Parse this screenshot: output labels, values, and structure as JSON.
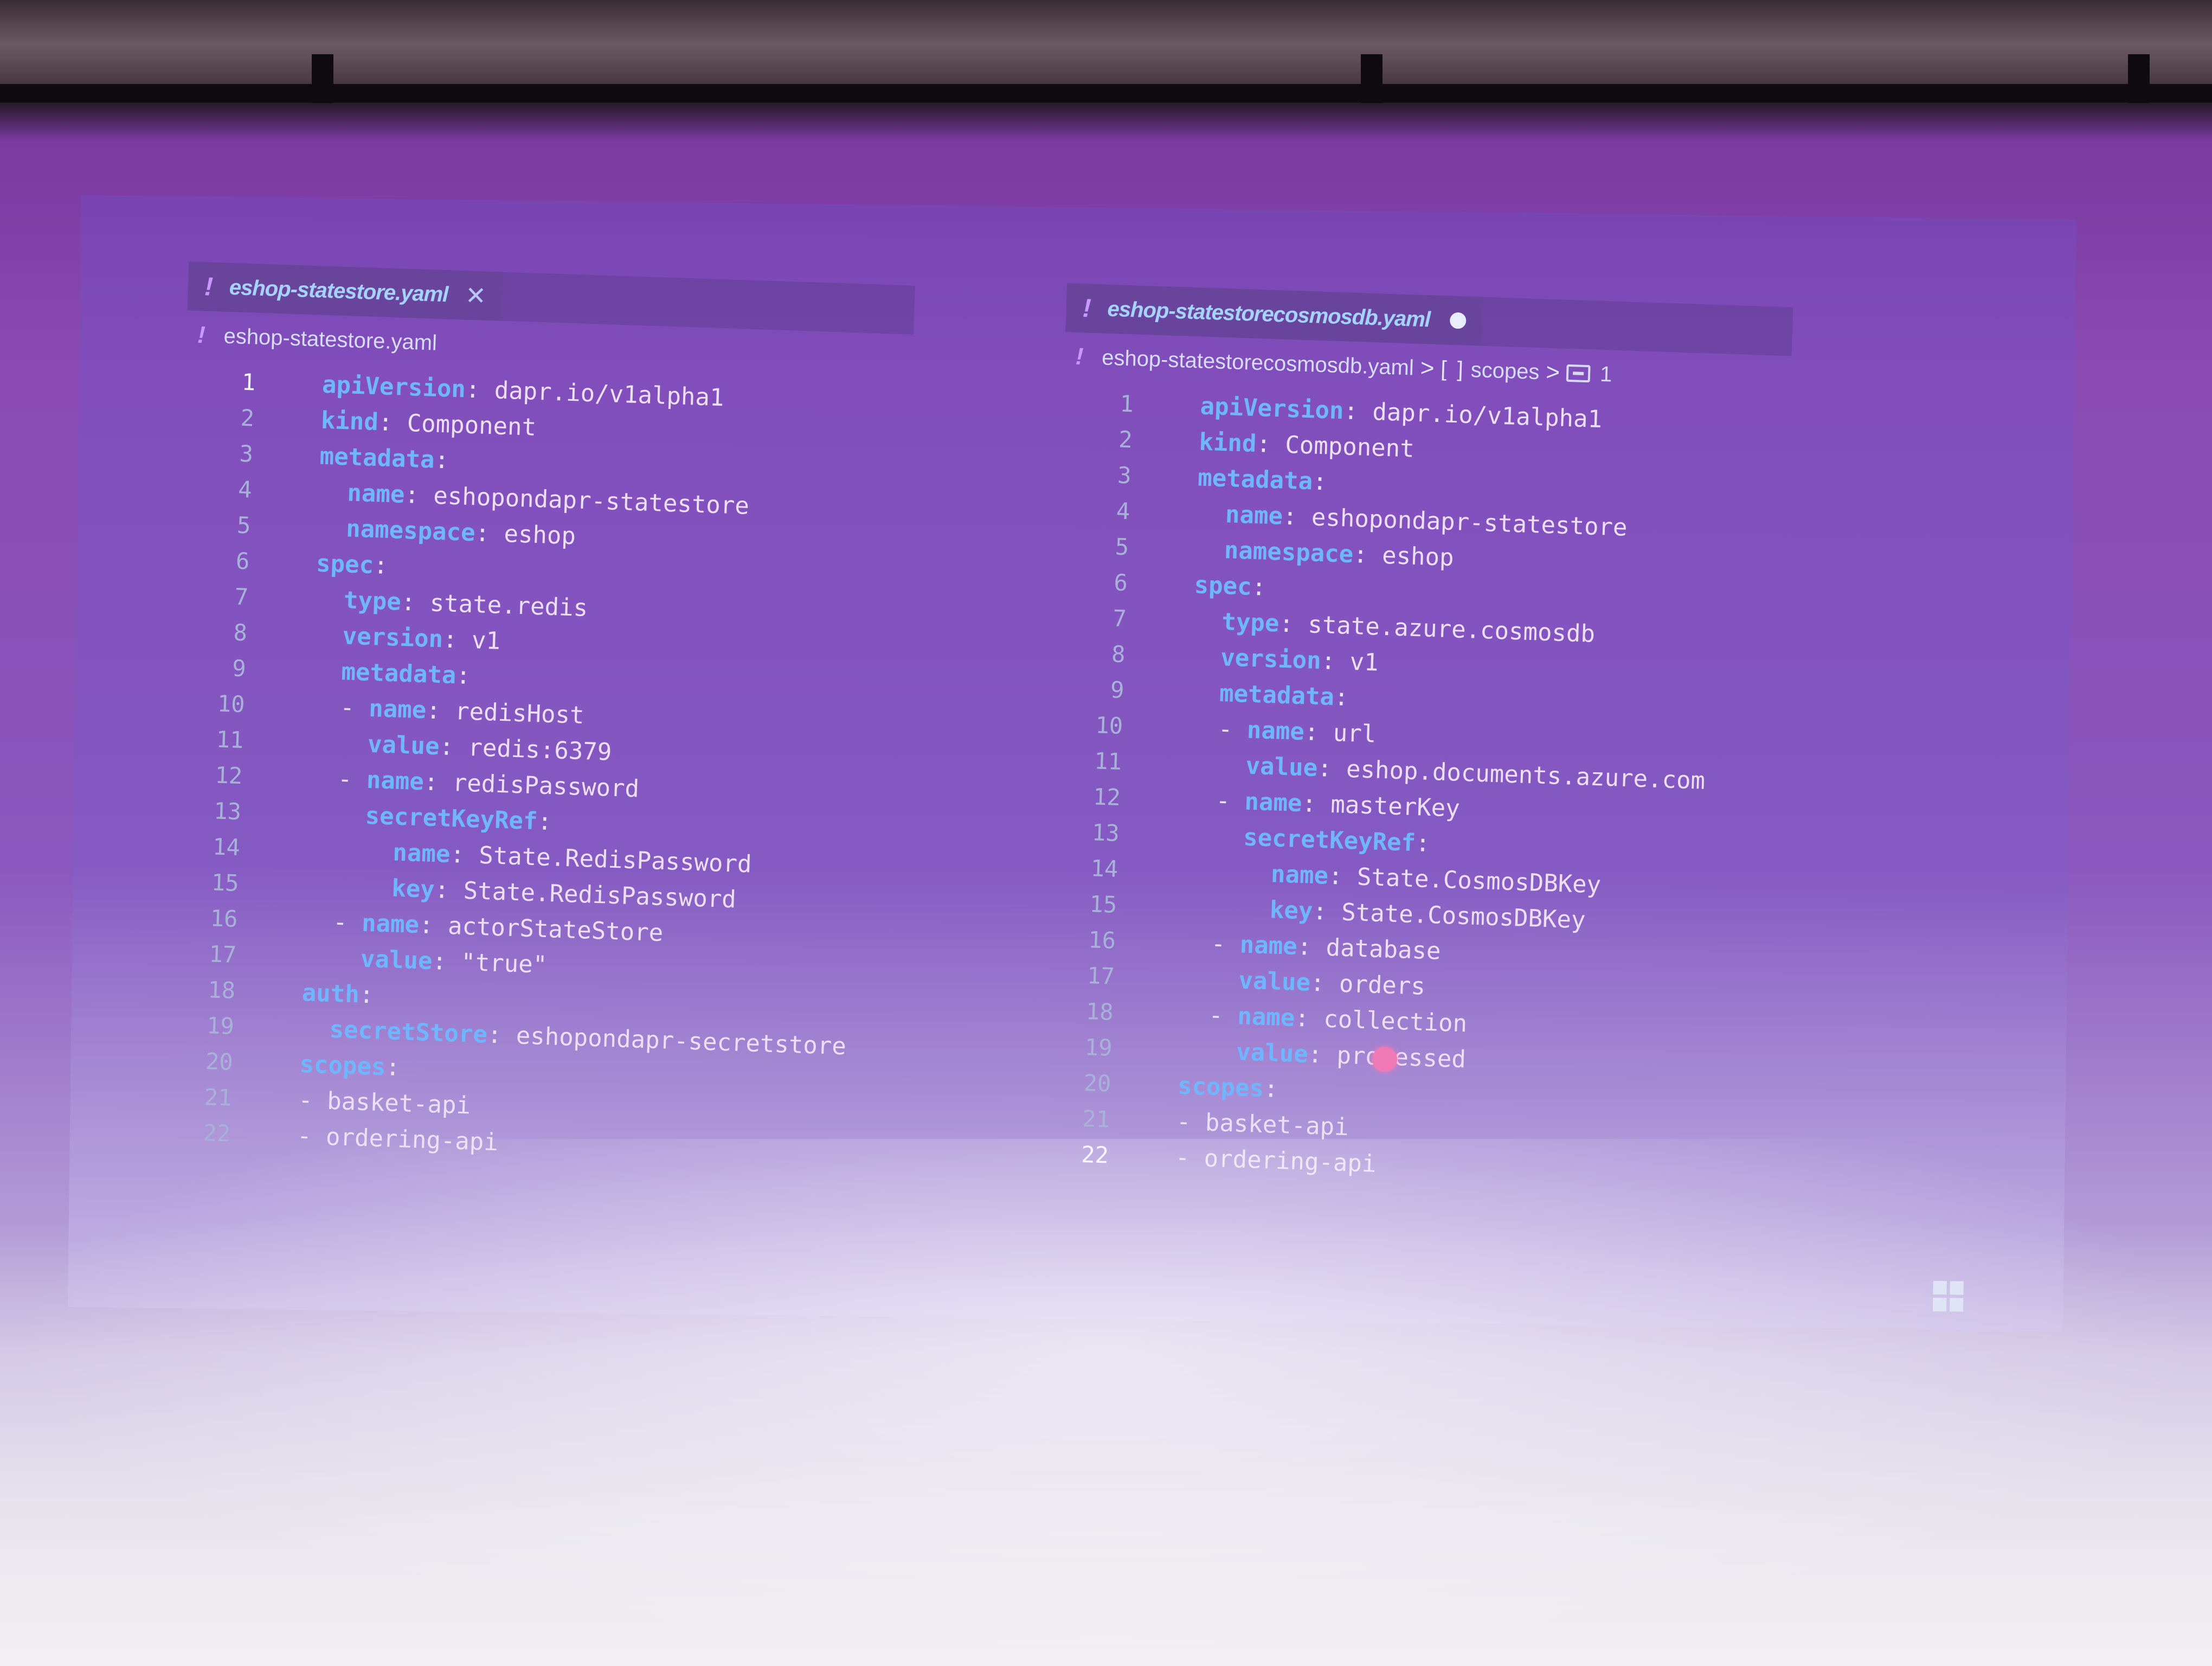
{
  "left_editor": {
    "tab_title": "eshop-statestore.yaml",
    "tab_close": "✕",
    "breadcrumb": "eshop-statestore.yaml",
    "lines": [
      {
        "n": "1",
        "indent": "  ",
        "key": "apiVersion",
        "sep": ": ",
        "val": "dapr.io/v1alpha1"
      },
      {
        "n": "2",
        "indent": "  ",
        "key": "kind",
        "sep": ": ",
        "val": "Component"
      },
      {
        "n": "3",
        "indent": "  ",
        "key": "metadata",
        "sep": ":",
        "val": ""
      },
      {
        "n": "4",
        "indent": "    ",
        "key": "name",
        "sep": ": ",
        "val": "eshopondapr-statestore"
      },
      {
        "n": "5",
        "indent": "    ",
        "key": "namespace",
        "sep": ": ",
        "val": "eshop"
      },
      {
        "n": "6",
        "indent": "  ",
        "key": "spec",
        "sep": ":",
        "val": ""
      },
      {
        "n": "7",
        "indent": "    ",
        "key": "type",
        "sep": ": ",
        "val": "state.redis"
      },
      {
        "n": "8",
        "indent": "    ",
        "key": "version",
        "sep": ": ",
        "val": "v1"
      },
      {
        "n": "9",
        "indent": "    ",
        "key": "metadata",
        "sep": ":",
        "val": ""
      },
      {
        "n": "10",
        "indent": "    - ",
        "key": "name",
        "sep": ": ",
        "val": "redisHost"
      },
      {
        "n": "11",
        "indent": "      ",
        "key": "value",
        "sep": ": ",
        "val": "redis:6379"
      },
      {
        "n": "12",
        "indent": "    - ",
        "key": "name",
        "sep": ": ",
        "val": "redisPassword"
      },
      {
        "n": "13",
        "indent": "      ",
        "key": "secretKeyRef",
        "sep": ":",
        "val": ""
      },
      {
        "n": "14",
        "indent": "        ",
        "key": "name",
        "sep": ": ",
        "val": "State.RedisPassword"
      },
      {
        "n": "15",
        "indent": "        ",
        "key": "key",
        "sep": ": ",
        "val": "State.RedisPassword"
      },
      {
        "n": "16",
        "indent": "    - ",
        "key": "name",
        "sep": ": ",
        "val": "actorStateStore"
      },
      {
        "n": "17",
        "indent": "      ",
        "key": "value",
        "sep": ": ",
        "val": "\"true\""
      },
      {
        "n": "18",
        "indent": "  ",
        "key": "auth",
        "sep": ":",
        "val": ""
      },
      {
        "n": "19",
        "indent": "    ",
        "key": "secretStore",
        "sep": ": ",
        "val": "eshopondapr-secretstore"
      },
      {
        "n": "20",
        "indent": "  ",
        "key": "scopes",
        "sep": ":",
        "val": ""
      },
      {
        "n": "21",
        "indent": "  - ",
        "key": "",
        "sep": "",
        "val": "basket-api"
      },
      {
        "n": "22",
        "indent": "  - ",
        "key": "",
        "sep": "",
        "val": "ordering-api"
      }
    ]
  },
  "right_editor": {
    "tab_title": "eshop-statestorecosmosdb.yaml",
    "breadcrumb": {
      "file": "eshop-statestorecosmosdb.yaml",
      "sep": ">",
      "bracket": "[ ]",
      "scope": "scopes",
      "item": "1"
    },
    "lines": [
      {
        "n": "1",
        "indent": "  ",
        "key": "apiVersion",
        "sep": ": ",
        "val": "dapr.io/v1alpha1"
      },
      {
        "n": "2",
        "indent": "  ",
        "key": "kind",
        "sep": ": ",
        "val": "Component"
      },
      {
        "n": "3",
        "indent": "  ",
        "key": "metadata",
        "sep": ":",
        "val": ""
      },
      {
        "n": "4",
        "indent": "    ",
        "key": "name",
        "sep": ": ",
        "val": "eshopondapr-statestore"
      },
      {
        "n": "5",
        "indent": "    ",
        "key": "namespace",
        "sep": ": ",
        "val": "eshop"
      },
      {
        "n": "6",
        "indent": "  ",
        "key": "spec",
        "sep": ":",
        "val": ""
      },
      {
        "n": "7",
        "indent": "    ",
        "key": "type",
        "sep": ": ",
        "val": "state.azure.cosmosdb"
      },
      {
        "n": "8",
        "indent": "    ",
        "key": "version",
        "sep": ": ",
        "val": "v1"
      },
      {
        "n": "9",
        "indent": "    ",
        "key": "metadata",
        "sep": ":",
        "val": ""
      },
      {
        "n": "10",
        "indent": "    - ",
        "key": "name",
        "sep": ": ",
        "val": "url"
      },
      {
        "n": "11",
        "indent": "      ",
        "key": "value",
        "sep": ": ",
        "val": "eshop.documents.azure.com"
      },
      {
        "n": "12",
        "indent": "    - ",
        "key": "name",
        "sep": ": ",
        "val": "masterKey"
      },
      {
        "n": "13",
        "indent": "      ",
        "key": "secretKeyRef",
        "sep": ":",
        "val": ""
      },
      {
        "n": "14",
        "indent": "        ",
        "key": "name",
        "sep": ": ",
        "val": "State.CosmosDBKey"
      },
      {
        "n": "15",
        "indent": "        ",
        "key": "key",
        "sep": ": ",
        "val": "State.CosmosDBKey"
      },
      {
        "n": "16",
        "indent": "    - ",
        "key": "name",
        "sep": ": ",
        "val": "database"
      },
      {
        "n": "17",
        "indent": "      ",
        "key": "value",
        "sep": ": ",
        "val": "orders"
      },
      {
        "n": "18",
        "indent": "    - ",
        "key": "name",
        "sep": ": ",
        "val": "collection"
      },
      {
        "n": "19",
        "indent": "      ",
        "key": "value",
        "sep": ": ",
        "val": "processed"
      },
      {
        "n": "20",
        "indent": "  ",
        "key": "scopes",
        "sep": ":",
        "val": ""
      },
      {
        "n": "21",
        "indent": "  - ",
        "key": "",
        "sep": "",
        "val": "basket-api"
      },
      {
        "n": "22",
        "indent": "  - ",
        "key": "",
        "sep": "",
        "val": "ordering-api"
      }
    ]
  },
  "icons": {
    "yaml_file": "exclamation-icon",
    "close": "close-icon",
    "unsaved": "dirty-dot-icon",
    "windows": "windows-logo-icon"
  },
  "colors": {
    "key": "#70b6ff",
    "value": "#ecdff4",
    "tab_title": "#a6d2ff",
    "yaml_icon": "#c897ff"
  }
}
